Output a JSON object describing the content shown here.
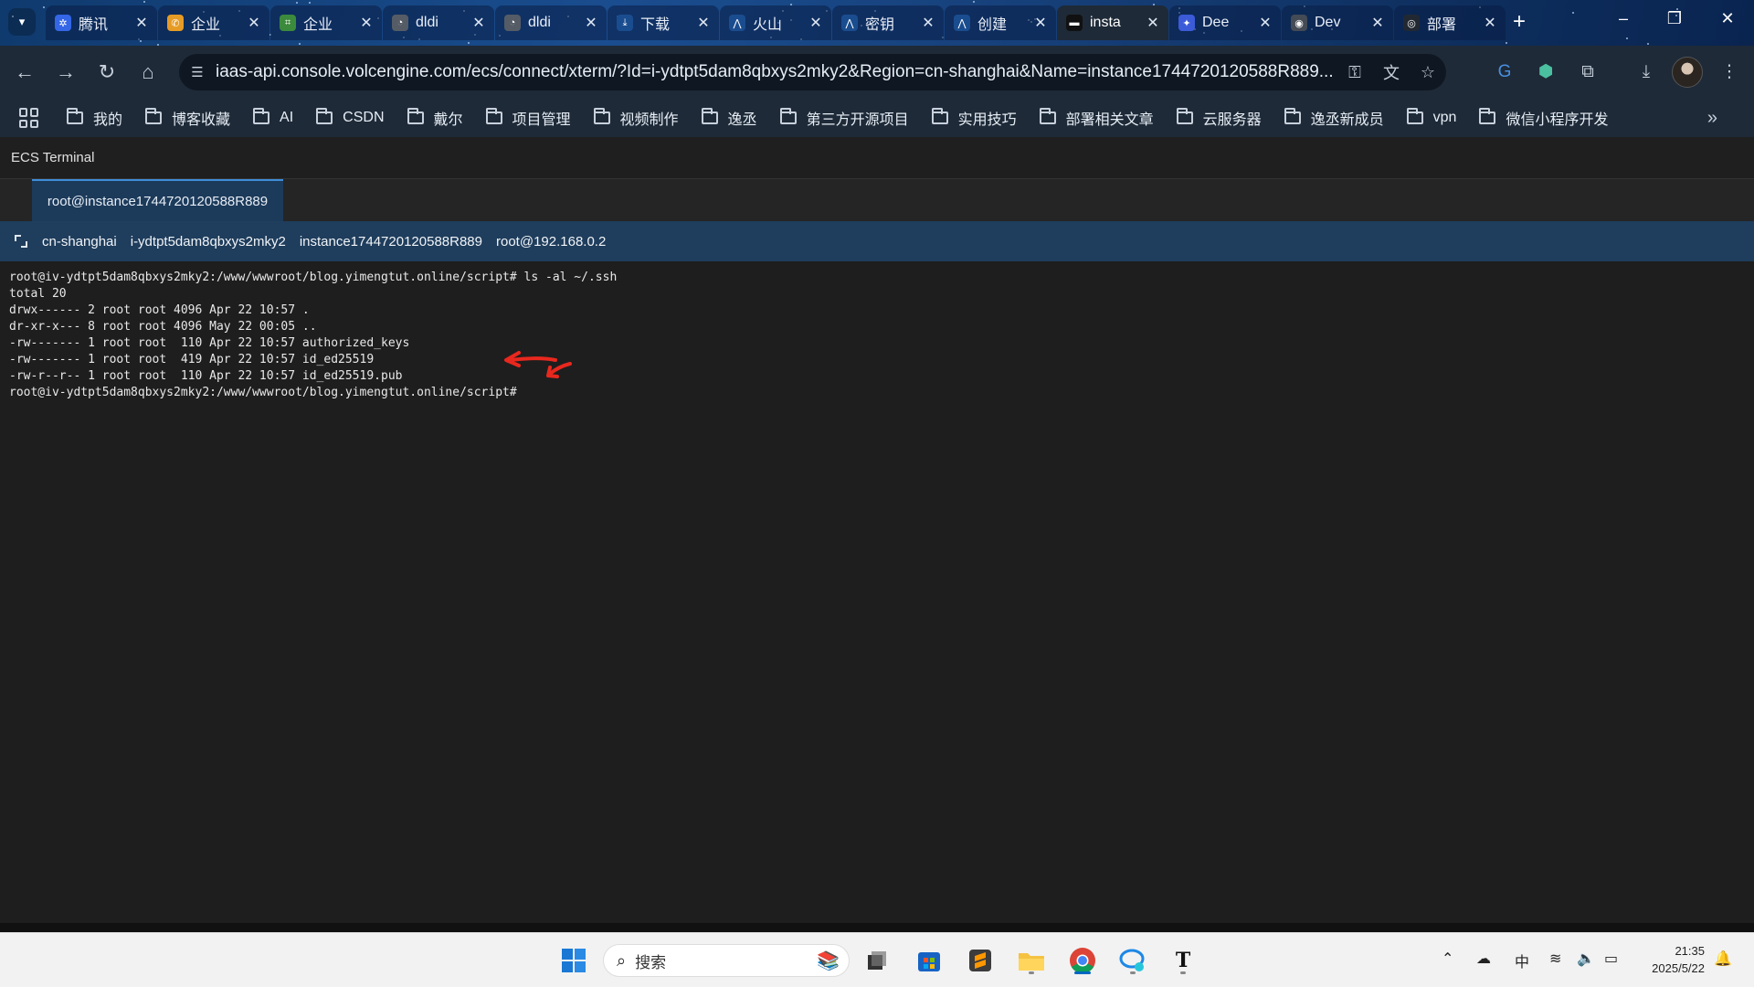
{
  "browser": {
    "tabs": [
      {
        "title": "腾讯",
        "fav_color": "#3466e6",
        "fav_glyph": "✲"
      },
      {
        "title": "企业",
        "fav_color": "#e69b25",
        "fav_glyph": "✆"
      },
      {
        "title": "企业",
        "fav_color": "#3c8a3c",
        "fav_glyph": "⌗"
      },
      {
        "title": "dldi",
        "fav_color": "#555c66",
        "fav_glyph": "◔"
      },
      {
        "title": "dldi",
        "fav_color": "#555c66",
        "fav_glyph": "◔"
      },
      {
        "title": "下载",
        "fav_color": "#1a4d8f",
        "fav_glyph": "⤓"
      },
      {
        "title": "火山",
        "fav_color": "#1a4d8f",
        "fav_glyph": "⋀"
      },
      {
        "title": "密钥",
        "fav_color": "#1a4d8f",
        "fav_glyph": "⋀"
      },
      {
        "title": "创建",
        "fav_color": "#1a4d8f",
        "fav_glyph": "⋀"
      },
      {
        "title": "insta",
        "fav_color": "#111111",
        "fav_glyph": "▬",
        "active": true
      },
      {
        "title": "Dee",
        "fav_color": "#3b5bd8",
        "fav_glyph": "✦"
      },
      {
        "title": "Dev",
        "fav_color": "#444b55",
        "fav_glyph": "◉"
      },
      {
        "title": "部署",
        "fav_color": "#222831",
        "fav_glyph": "◎"
      }
    ],
    "tab_close_glyph": "✕",
    "url": "iaas-api.console.volcengine.com/ecs/connect/xterm/?Id=i-ydtpt5dam8qbxys2mky2&Region=cn-shanghai&Name=instance1744720120588R889...",
    "bookmarks": [
      "我的",
      "博客收藏",
      "AI",
      "CSDN",
      "戴尔",
      "项目管理",
      "视频制作",
      "逸丞",
      "第三方开源项目",
      "实用技巧",
      "部署相关文章",
      "云服务器",
      "逸丞新成员",
      "vpn",
      "微信小程序开发"
    ]
  },
  "ecs": {
    "app_title": "ECS Terminal",
    "session_tab": "root@instance1744720120588R889",
    "info": {
      "region": "cn-shanghai",
      "instance_id": "i-ydtpt5dam8qbxys2mky2",
      "instance_name": "instance1744720120588R889",
      "user_host": "root@192.168.0.2"
    },
    "terminal_lines": [
      "root@iv-ydtpt5dam8qbxys2mky2:/www/wwwroot/blog.yimengtut.online/script# ls -al ~/.ssh",
      "total 20",
      "drwx------ 2 root root 4096 Apr 22 10:57 .",
      "dr-xr-x--- 8 root root 4096 May 22 00:05 ..",
      "-rw------- 1 root root  110 Apr 22 10:57 authorized_keys",
      "-rw------- 1 root root  419 Apr 22 10:57 id_ed25519",
      "-rw-r--r-- 1 root root  110 Apr 22 10:57 id_ed25519.pub",
      "root@iv-ydtpt5dam8qbxys2mky2:/www/wwwroot/blog.yimengtut.online/script# "
    ],
    "annotation_color": "#e8281e"
  },
  "taskbar": {
    "search_placeholder": "搜索",
    "ime": "中",
    "time": "21:35",
    "date": "2025/5/22"
  }
}
